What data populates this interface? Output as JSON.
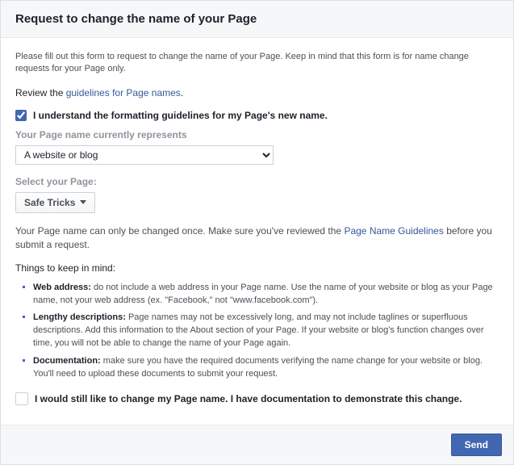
{
  "header": {
    "title": "Request to change the name of your Page"
  },
  "intro": "Please fill out this form to request to change the name of your Page. Keep in mind that this form is for name change requests for your Page only.",
  "review": {
    "prefix": "Review the ",
    "link": "guidelines for Page names",
    "suffix": "."
  },
  "understandCheckbox": {
    "checked": true,
    "label": "I understand the formatting guidelines for my Page's new name."
  },
  "representsLabel": "Your Page name currently represents",
  "representsSelected": "A website or blog",
  "selectPageLabel": "Select your Page:",
  "selectedPage": "Safe Tricks",
  "warning": {
    "pre": "Your Page name can only be changed once. Make sure you've reviewed the ",
    "link": "Page Name Guidelines",
    "post": " before you submit a request."
  },
  "mindTitle": "Things to keep in mind:",
  "mind": [
    {
      "bold": "Web address:",
      "text": " do not include a web address in your Page name. Use the name of your website or blog as your Page name, not your web address (ex. \"Facebook,\" not \"www.facebook.com\")."
    },
    {
      "bold": "Lengthy descriptions:",
      "text": " Page names may not be excessively long, and may not include taglines or superfluous descriptions. Add this information to the About section of your Page. If your website or blog's function changes over time, you will not be able to change the name of your Page again."
    },
    {
      "bold": "Documentation:",
      "text": " make sure you have the required documents verifying the name change for your website or blog. You'll need to upload these documents to submit your request."
    }
  ],
  "stillCheckbox": {
    "checked": false,
    "label": "I would still like to change my Page name. I have documentation to demonstrate this change."
  },
  "footer": {
    "send": "Send"
  }
}
